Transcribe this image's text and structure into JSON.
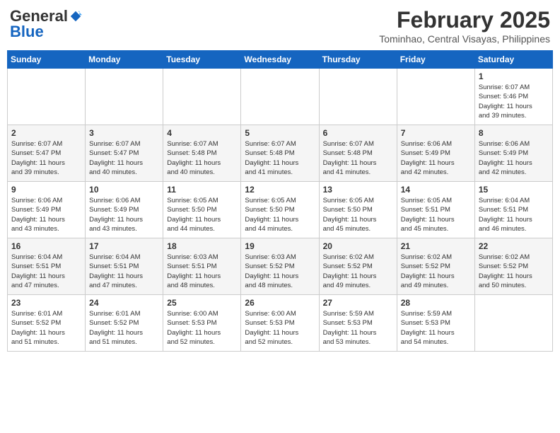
{
  "header": {
    "logo_general": "General",
    "logo_blue": "Blue",
    "month_year": "February 2025",
    "location": "Tominhao, Central Visayas, Philippines"
  },
  "days_of_week": [
    "Sunday",
    "Monday",
    "Tuesday",
    "Wednesday",
    "Thursday",
    "Friday",
    "Saturday"
  ],
  "weeks": [
    [
      {
        "day": "",
        "info": ""
      },
      {
        "day": "",
        "info": ""
      },
      {
        "day": "",
        "info": ""
      },
      {
        "day": "",
        "info": ""
      },
      {
        "day": "",
        "info": ""
      },
      {
        "day": "",
        "info": ""
      },
      {
        "day": "1",
        "info": "Sunrise: 6:07 AM\nSunset: 5:46 PM\nDaylight: 11 hours\nand 39 minutes."
      }
    ],
    [
      {
        "day": "2",
        "info": "Sunrise: 6:07 AM\nSunset: 5:47 PM\nDaylight: 11 hours\nand 39 minutes."
      },
      {
        "day": "3",
        "info": "Sunrise: 6:07 AM\nSunset: 5:47 PM\nDaylight: 11 hours\nand 40 minutes."
      },
      {
        "day": "4",
        "info": "Sunrise: 6:07 AM\nSunset: 5:48 PM\nDaylight: 11 hours\nand 40 minutes."
      },
      {
        "day": "5",
        "info": "Sunrise: 6:07 AM\nSunset: 5:48 PM\nDaylight: 11 hours\nand 41 minutes."
      },
      {
        "day": "6",
        "info": "Sunrise: 6:07 AM\nSunset: 5:48 PM\nDaylight: 11 hours\nand 41 minutes."
      },
      {
        "day": "7",
        "info": "Sunrise: 6:06 AM\nSunset: 5:49 PM\nDaylight: 11 hours\nand 42 minutes."
      },
      {
        "day": "8",
        "info": "Sunrise: 6:06 AM\nSunset: 5:49 PM\nDaylight: 11 hours\nand 42 minutes."
      }
    ],
    [
      {
        "day": "9",
        "info": "Sunrise: 6:06 AM\nSunset: 5:49 PM\nDaylight: 11 hours\nand 43 minutes."
      },
      {
        "day": "10",
        "info": "Sunrise: 6:06 AM\nSunset: 5:49 PM\nDaylight: 11 hours\nand 43 minutes."
      },
      {
        "day": "11",
        "info": "Sunrise: 6:05 AM\nSunset: 5:50 PM\nDaylight: 11 hours\nand 44 minutes."
      },
      {
        "day": "12",
        "info": "Sunrise: 6:05 AM\nSunset: 5:50 PM\nDaylight: 11 hours\nand 44 minutes."
      },
      {
        "day": "13",
        "info": "Sunrise: 6:05 AM\nSunset: 5:50 PM\nDaylight: 11 hours\nand 45 minutes."
      },
      {
        "day": "14",
        "info": "Sunrise: 6:05 AM\nSunset: 5:51 PM\nDaylight: 11 hours\nand 45 minutes."
      },
      {
        "day": "15",
        "info": "Sunrise: 6:04 AM\nSunset: 5:51 PM\nDaylight: 11 hours\nand 46 minutes."
      }
    ],
    [
      {
        "day": "16",
        "info": "Sunrise: 6:04 AM\nSunset: 5:51 PM\nDaylight: 11 hours\nand 47 minutes."
      },
      {
        "day": "17",
        "info": "Sunrise: 6:04 AM\nSunset: 5:51 PM\nDaylight: 11 hours\nand 47 minutes."
      },
      {
        "day": "18",
        "info": "Sunrise: 6:03 AM\nSunset: 5:51 PM\nDaylight: 11 hours\nand 48 minutes."
      },
      {
        "day": "19",
        "info": "Sunrise: 6:03 AM\nSunset: 5:52 PM\nDaylight: 11 hours\nand 48 minutes."
      },
      {
        "day": "20",
        "info": "Sunrise: 6:02 AM\nSunset: 5:52 PM\nDaylight: 11 hours\nand 49 minutes."
      },
      {
        "day": "21",
        "info": "Sunrise: 6:02 AM\nSunset: 5:52 PM\nDaylight: 11 hours\nand 49 minutes."
      },
      {
        "day": "22",
        "info": "Sunrise: 6:02 AM\nSunset: 5:52 PM\nDaylight: 11 hours\nand 50 minutes."
      }
    ],
    [
      {
        "day": "23",
        "info": "Sunrise: 6:01 AM\nSunset: 5:52 PM\nDaylight: 11 hours\nand 51 minutes."
      },
      {
        "day": "24",
        "info": "Sunrise: 6:01 AM\nSunset: 5:52 PM\nDaylight: 11 hours\nand 51 minutes."
      },
      {
        "day": "25",
        "info": "Sunrise: 6:00 AM\nSunset: 5:53 PM\nDaylight: 11 hours\nand 52 minutes."
      },
      {
        "day": "26",
        "info": "Sunrise: 6:00 AM\nSunset: 5:53 PM\nDaylight: 11 hours\nand 52 minutes."
      },
      {
        "day": "27",
        "info": "Sunrise: 5:59 AM\nSunset: 5:53 PM\nDaylight: 11 hours\nand 53 minutes."
      },
      {
        "day": "28",
        "info": "Sunrise: 5:59 AM\nSunset: 5:53 PM\nDaylight: 11 hours\nand 54 minutes."
      },
      {
        "day": "",
        "info": ""
      }
    ]
  ]
}
